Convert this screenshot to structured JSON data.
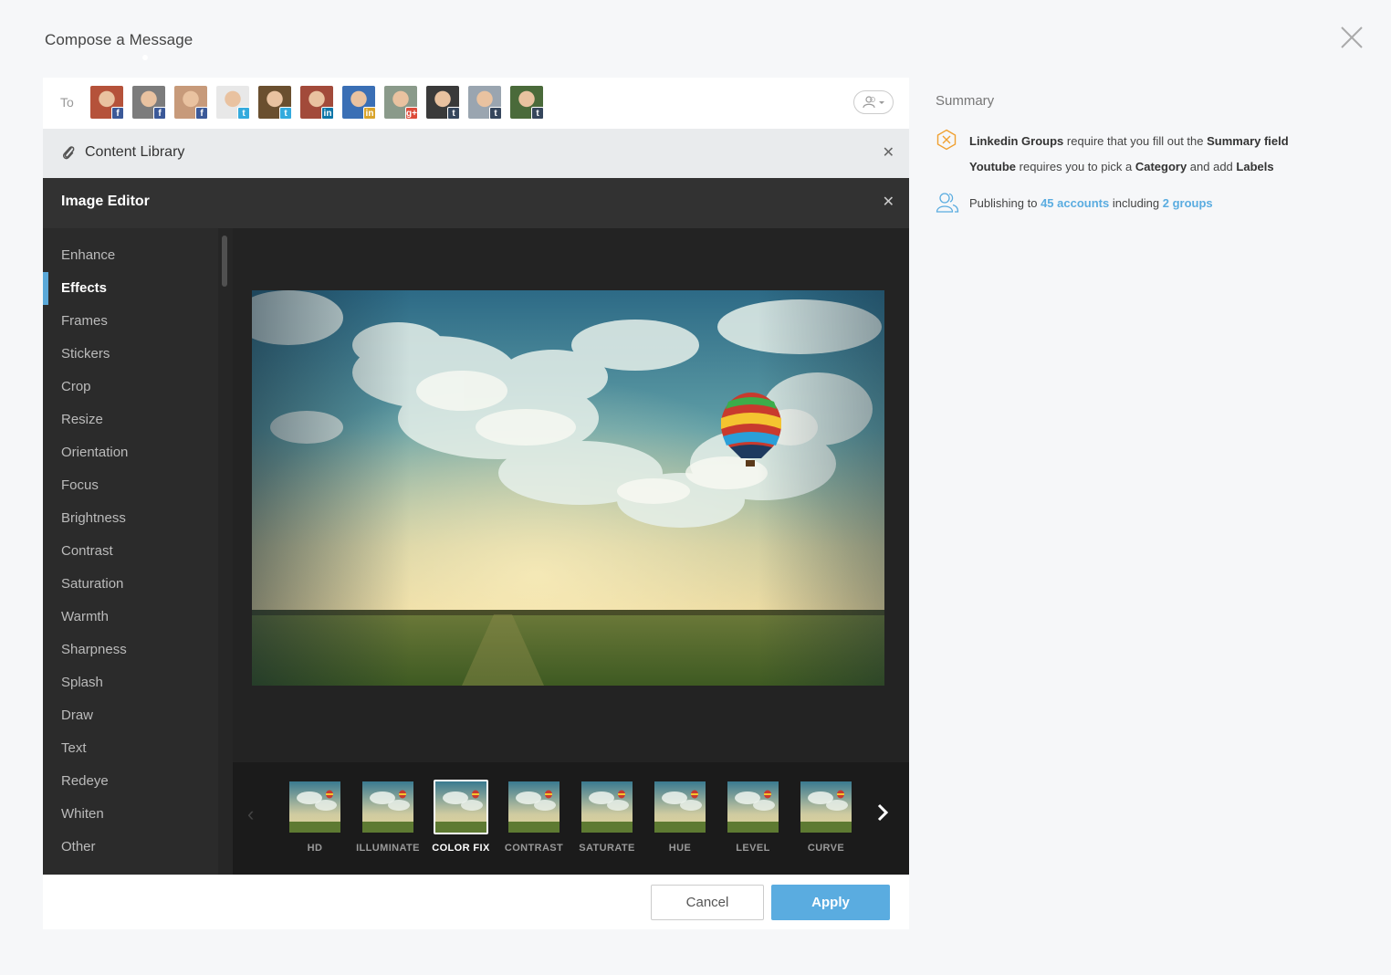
{
  "header": {
    "title": "Compose a Message"
  },
  "to_bar": {
    "label": "To",
    "recipients": [
      {
        "network": "facebook",
        "badge": "f"
      },
      {
        "network": "facebook",
        "badge": "f"
      },
      {
        "network": "facebook",
        "badge": "f"
      },
      {
        "network": "twitter",
        "badge": "t"
      },
      {
        "network": "twitter",
        "badge": "t"
      },
      {
        "network": "linkedin",
        "badge": "in"
      },
      {
        "network": "linkedin",
        "badge": "in"
      },
      {
        "network": "google-plus",
        "badge": "g+"
      },
      {
        "network": "tumblr",
        "badge": "t"
      },
      {
        "network": "tumblr",
        "badge": "t"
      },
      {
        "network": "tumblr",
        "badge": "t"
      }
    ]
  },
  "content_library": {
    "label": "Content Library"
  },
  "image_editor": {
    "title": "Image Editor",
    "tools": [
      "Enhance",
      "Effects",
      "Frames",
      "Stickers",
      "Crop",
      "Resize",
      "Orientation",
      "Focus",
      "Brightness",
      "Contrast",
      "Saturation",
      "Warmth",
      "Sharpness",
      "Splash",
      "Draw",
      "Text",
      "Redeye",
      "Whiten",
      "Other"
    ],
    "active_tool": "Effects",
    "filters": [
      "HD",
      "ILLUMINATE",
      "COLOR FIX",
      "CONTRAST",
      "SATURATE",
      "HUE",
      "LEVEL",
      "CURVE"
    ],
    "active_filter": "COLOR FIX"
  },
  "footer": {
    "cancel_label": "Cancel",
    "apply_label": "Apply"
  },
  "summary": {
    "title": "Summary",
    "warning_line1": {
      "bold1": "Linkedin Groups",
      "text1": " require that you fill out the ",
      "bold2": "Summary field"
    },
    "warning_line2": {
      "bold1": "Youtube",
      "text1": " requires you to pick a ",
      "bold2": "Category",
      "text2": " and add ",
      "bold3": "Labels"
    },
    "publishing": {
      "prefix": "Publishing to ",
      "accounts_link": "45 accounts",
      "middle": " including ",
      "groups_link": "2 groups"
    }
  },
  "colors": {
    "accent": "#5aace0",
    "warning": "#f0a030"
  }
}
